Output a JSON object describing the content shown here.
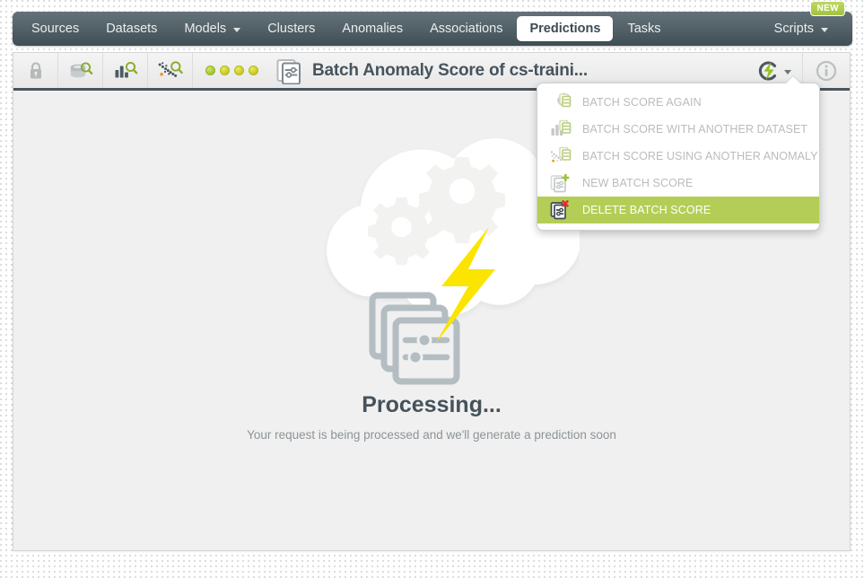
{
  "nav": {
    "items": [
      {
        "label": "Sources",
        "active": false,
        "dropdown": false
      },
      {
        "label": "Datasets",
        "active": false,
        "dropdown": false
      },
      {
        "label": "Models",
        "active": false,
        "dropdown": true
      },
      {
        "label": "Clusters",
        "active": false,
        "dropdown": false
      },
      {
        "label": "Anomalies",
        "active": false,
        "dropdown": false
      },
      {
        "label": "Associations",
        "active": false,
        "dropdown": false
      },
      {
        "label": "Predictions",
        "active": true,
        "dropdown": false
      },
      {
        "label": "Tasks",
        "active": false,
        "dropdown": false
      }
    ],
    "right": {
      "label": "Scripts",
      "dropdown": true,
      "badge": "NEW",
      "badge_color": "#a9c63f"
    }
  },
  "toolbar": {
    "buttons": [
      {
        "name": "lock-icon",
        "title": "Privacy"
      },
      {
        "name": "dataset-search-icon",
        "title": "Dataset"
      },
      {
        "name": "model-search-icon",
        "title": "Model"
      },
      {
        "name": "anomaly-search-icon",
        "title": "Anomaly"
      }
    ],
    "status_dots": 4,
    "title": "Batch Anomaly Score of cs-traini...",
    "title_icon": "batch-score-icon",
    "action_icon": "batch-anomaly-score-icon",
    "info_icon": "info-icon"
  },
  "menu": {
    "items": [
      {
        "label": "BATCH SCORE AGAIN",
        "icon": "refresh-batch-score-icon",
        "highlight": false
      },
      {
        "label": "BATCH SCORE WITH ANOTHER DATASET",
        "icon": "dataset-batch-score-icon",
        "highlight": false
      },
      {
        "label": "BATCH SCORE USING ANOTHER ANOMALY",
        "icon": "anomaly-batch-score-icon",
        "highlight": false
      },
      {
        "label": "NEW BATCH SCORE",
        "icon": "new-batch-score-icon",
        "highlight": false
      },
      {
        "label": "DELETE BATCH SCORE",
        "icon": "delete-batch-score-icon",
        "highlight": true
      }
    ],
    "highlight_color": "#b4cd57"
  },
  "main": {
    "illustration": "cloud-gears-lightning-processing-illustration",
    "heading": "Processing...",
    "subheading": "Your request is being processed and we'll generate a prediction soon"
  },
  "colors": {
    "nav_top": "#63727a",
    "nav_bottom": "#3f4d55",
    "accent_green": "#b4cd57",
    "lightning_yellow": "#ffe500",
    "panel_bg": "#f0f0f0",
    "heading": "#45525b"
  }
}
